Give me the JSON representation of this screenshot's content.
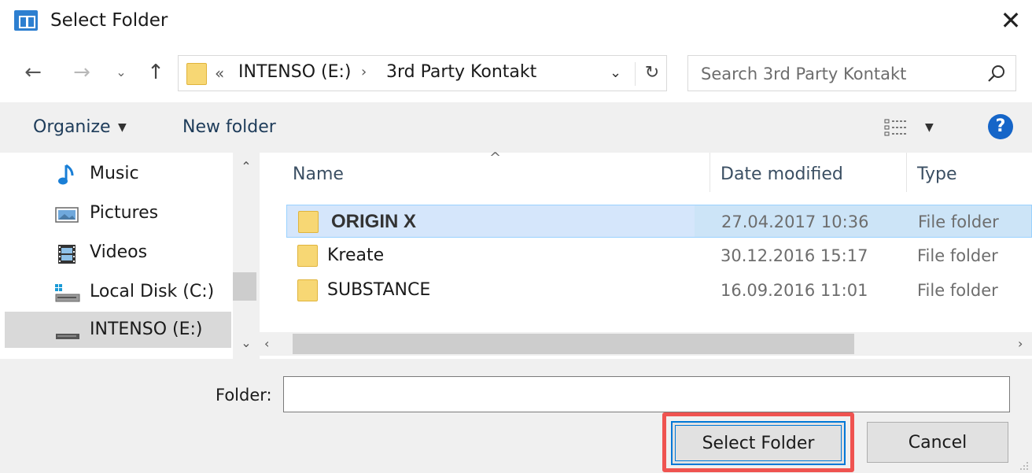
{
  "window": {
    "title": "Select Folder",
    "close_glyph": "✕"
  },
  "nav": {
    "back_glyph": "←",
    "forward_glyph": "→",
    "recent_glyph": "⌄",
    "up_glyph": "↑",
    "address": {
      "prefix": "«",
      "crumbs": [
        "INTENSO (E:)",
        "3rd Party Kontakt"
      ],
      "separator": "›",
      "dropdown_glyph": "⌄",
      "refresh_glyph": "↻"
    },
    "search": {
      "placeholder": "Search 3rd Party Kontakt"
    }
  },
  "toolbar": {
    "organize_label": "Organize",
    "organize_caret": "▼",
    "new_folder_label": "New folder",
    "view_caret": "▼",
    "help_glyph": "?"
  },
  "sidebar": {
    "scroll_up_glyph": "⌃",
    "scroll_down_glyph": "⌄",
    "items": [
      {
        "label": "Music",
        "icon": "music-icon",
        "selected": false
      },
      {
        "label": "Pictures",
        "icon": "pictures-icon",
        "selected": false
      },
      {
        "label": "Videos",
        "icon": "videos-icon",
        "selected": false
      },
      {
        "label": "Local Disk (C:)",
        "icon": "local-disk-icon",
        "selected": false
      },
      {
        "label": "INTENSO (E:)",
        "icon": "drive-icon",
        "selected": true
      }
    ]
  },
  "file_list": {
    "sort_glyph": "^",
    "columns": {
      "name": "Name",
      "date": "Date modified",
      "type": "Type"
    },
    "rows": [
      {
        "name": "ORIGIN X",
        "date": "27.04.2017 10:36",
        "type": "File folder",
        "selected": true
      },
      {
        "name": "Kreate",
        "date": "30.12.2016 15:17",
        "type": "File folder",
        "selected": false
      },
      {
        "name": "SUBSTANCE",
        "date": "16.09.2016 11:01",
        "type": "File folder",
        "selected": false
      }
    ],
    "hscroll_left_glyph": "‹",
    "hscroll_right_glyph": "›"
  },
  "footer": {
    "folder_label": "Folder:",
    "folder_value": "",
    "select_button": "Select Folder",
    "cancel_button": "Cancel"
  },
  "colors": {
    "accent": "#0078d7",
    "highlight": "#ef5350",
    "selection": "#cce4f7"
  }
}
